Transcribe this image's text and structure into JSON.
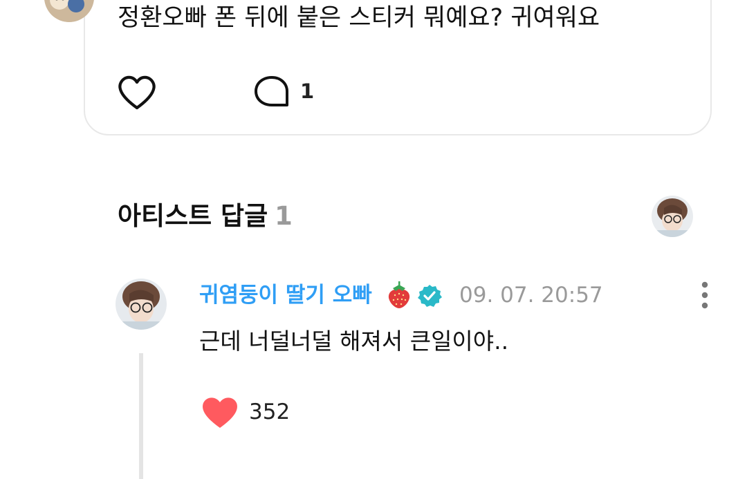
{
  "post": {
    "text": "정환오빠 폰 뒤에 붙은 스티커 뭐예요? 귀여워요",
    "comment_count": "1",
    "icons": {
      "like": "heart-outline-icon",
      "comment": "comment-bubble-icon"
    }
  },
  "artist_replies": {
    "title": "아티스트 답글",
    "count": "1"
  },
  "reply": {
    "author": "귀염둥이 딸기 오빠",
    "author_badges": [
      "strawberry-emoji-icon",
      "verified-badge-icon"
    ],
    "timestamp": "09. 07. 20:57",
    "text": "근데 너덜너덜 해져서 큰일이야..",
    "like_count": "352",
    "liked": true
  },
  "colors": {
    "author_name": "#2f9ef5",
    "verified_badge": "#2ab9c8",
    "liked_heart": "#ff5a5f",
    "muted_text": "#9a9a9a",
    "card_border": "#e8e8e8",
    "thread_line": "#e4e4e4"
  }
}
